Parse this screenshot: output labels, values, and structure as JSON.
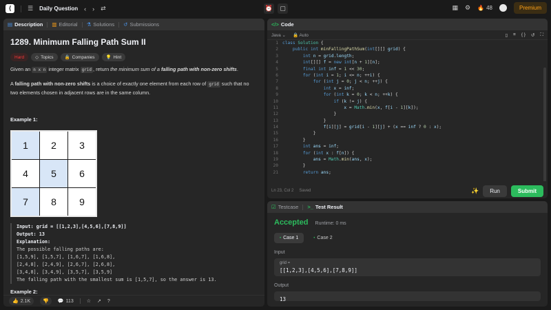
{
  "topbar": {
    "title": "Daily Question",
    "streak": "48",
    "premium": "Premium"
  },
  "left": {
    "tabs": [
      "Description",
      "Editorial",
      "Solutions",
      "Submissions"
    ],
    "problem_title": "1289. Minimum Falling Path Sum II",
    "tags": [
      "Hard",
      "Topics",
      "Companies",
      "Hint"
    ],
    "para1": {
      "a": "Given an ",
      "code1": "n x n",
      "b": " integer matrix ",
      "code2": "grid",
      "c": ", return ",
      "i": "the minimum sum of a",
      "bold": "falling path with non-zero shifts",
      "d": "."
    },
    "para2": {
      "bold": "falling path with non-zero shifts",
      "a": "A ",
      "b": " is a choice of exactly one element from each row of ",
      "code": "grid",
      "c": " such that no two elements chosen in adjacent rows are in the same column."
    },
    "example1_title": "Example 1:",
    "grid_cells": [
      "1",
      "2",
      "3",
      "4",
      "5",
      "6",
      "7",
      "8",
      "9"
    ],
    "example1_lines": [
      "Input: grid = [[1,2,3],[4,5,6],[7,8,9]]",
      "Output: 13",
      "Explanation:",
      "The possible falling paths are:",
      "[1,5,9], [1,5,7], [1,6,7], [1,6,8],",
      "[2,4,8], [2,4,9], [2,6,7], [2,6,8],",
      "[3,4,8], [3,4,9], [3,5,7], [3,5,9]",
      "The falling path with the smallest sum is [1,5,7], so the answer is 13."
    ],
    "example2_title": "Example 2:",
    "footer": {
      "likes": "2.1K",
      "comments": "113"
    }
  },
  "code": {
    "tab": "Code",
    "language": "Java",
    "mode": "Auto",
    "status": "Ln 23, Col 2",
    "saved": "Saved",
    "run": "Run",
    "submit": "Submit",
    "line_numbers": [
      "1",
      "2",
      "3",
      "4",
      "5",
      "6",
      "7",
      "8",
      "9",
      "10",
      "11",
      "12",
      "13",
      "14",
      "15",
      "16",
      "17",
      "18",
      "19",
      "20",
      "21"
    ]
  },
  "result": {
    "tabs": [
      "Testcase",
      "Test Result"
    ],
    "verdict": "Accepted",
    "runtime": "Runtime: 0 ms",
    "cases": [
      "Case 1",
      "Case 2"
    ],
    "input_label": "Input",
    "input_name": "grid =",
    "input_value": "[[1,2,3],[4,5,6],[7,8,9]]",
    "output_label": "Output",
    "output_value": "13"
  },
  "colors": {
    "accepted": "#2cbb5d",
    "hard": "#f63737",
    "premium": "#ffa116",
    "submit": "#2cbb5d"
  }
}
